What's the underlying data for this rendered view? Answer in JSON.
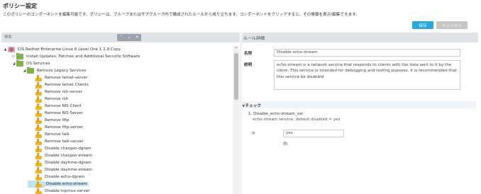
{
  "page": {
    "title": "ポリシー設定",
    "description": "このポリシーのコンポーネントを編集可能です。ポリシーは、グループまたはサブグループ内で構成されたルールから成り立ちます。コンポーネントをクリックすると、その情報を表示/編集できます。"
  },
  "actions": {
    "save_label": "保存",
    "cancel_label": "キャンセル"
  },
  "search": {
    "placeholder": "検索",
    "up_glyph": "⌃",
    "down_glyph": "⌄",
    "close_glyph": "✕"
  },
  "tree": {
    "rows": [
      {
        "label": "CIS Redhat Enterprise Linux 6 Level One 1.1.0 Copy",
        "toggle": "▲",
        "icon": "root"
      },
      {
        "label": "Install Updates, Patches and Additional Security Software",
        "toggle": "▷",
        "icon": "folder"
      },
      {
        "label": "OS Services",
        "toggle": "◢",
        "icon": "folder"
      },
      {
        "label": "Remove Legacy Services",
        "toggle": "◢",
        "icon": "folder"
      },
      {
        "label": "Remove telnet-server",
        "icon": "rule"
      },
      {
        "label": "Remove telnet Clients",
        "icon": "rule"
      },
      {
        "label": "Remove rsh-server",
        "icon": "rule"
      },
      {
        "label": "Remove rsh",
        "icon": "rule"
      },
      {
        "label": "Remove NIS Client",
        "icon": "rule"
      },
      {
        "label": "Remove NIS Server",
        "icon": "rule"
      },
      {
        "label": "Remove tftp",
        "icon": "rule"
      },
      {
        "label": "Remove tftp-server",
        "icon": "rule"
      },
      {
        "label": "Remove talk",
        "icon": "rule"
      },
      {
        "label": "Remove talk-server",
        "icon": "rule"
      },
      {
        "label": "Disable chargen-dgram",
        "icon": "rule"
      },
      {
        "label": "Disable chargen-stream",
        "icon": "rule"
      },
      {
        "label": "Disable daytime-dgram",
        "icon": "rule"
      },
      {
        "label": "Disable daytime-stream",
        "icon": "rule"
      },
      {
        "label": "Disable echo-dgram",
        "icon": "rule"
      },
      {
        "label": "Disable echo-stream",
        "icon": "rule",
        "selected": true
      },
      {
        "label": "Disable tcpmux-server",
        "icon": "rule"
      }
    ],
    "scroll_up_glyph": "⌃"
  },
  "rule_details": {
    "header": "ルール詳細",
    "name_label": "名称",
    "name_value": "Disable echo-stream",
    "desc_label": "説明",
    "desc_value": "echo-stream is a network service that responds to clients with the data sent to it by the client. This service is intended for debugging and testing puposes. It is recommended that this service be disabled.",
    "check_header": "∨チェック",
    "check_name": "1. Disable_echo-stream_val",
    "check_desc": "echo-stream service, default disabled = yes",
    "is_label": "is",
    "value": "yes",
    "example_label": "例:"
  }
}
